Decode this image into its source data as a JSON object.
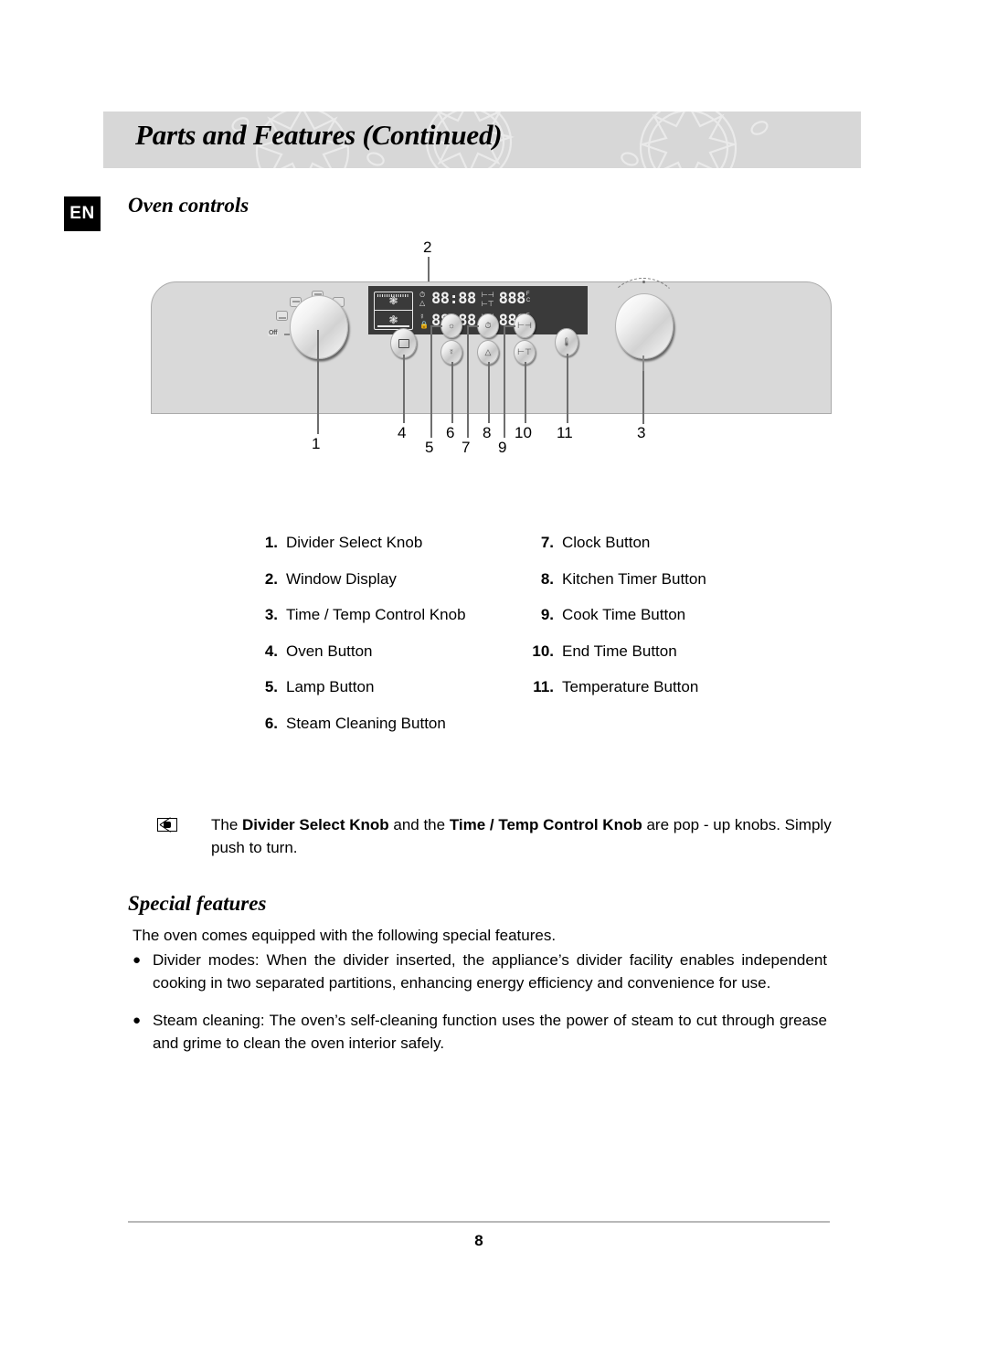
{
  "header": {
    "title": "Parts and Features (Continued)",
    "background_color": "#d7d7d7"
  },
  "language_badge": "EN",
  "sections": {
    "oven_controls_title": "Oven controls",
    "special_features_title": "Special features"
  },
  "diagram": {
    "callouts": [
      {
        "num": "1",
        "label": "Divider Select Knob"
      },
      {
        "num": "2",
        "label": "Window Display"
      },
      {
        "num": "3",
        "label": "Time / Temp Control Knob"
      },
      {
        "num": "4",
        "label": "Oven Button"
      },
      {
        "num": "5",
        "label": "Lamp Button"
      },
      {
        "num": "6",
        "label": "Steam Cleaning Button"
      },
      {
        "num": "7",
        "label": "Clock Button"
      },
      {
        "num": "8",
        "label": "Kitchen Timer Button"
      },
      {
        "num": "9",
        "label": "Cook Time Button"
      },
      {
        "num": "10",
        "label": "End Time Button"
      },
      {
        "num": "11",
        "label": "Temperature Button"
      }
    ],
    "knob_off_label": "Off",
    "lcd": {
      "panel_color": "#3a3a3a",
      "rows": [
        {
          "icons": [
            "clock-icon",
            "bell-icon"
          ],
          "time": "88:88",
          "brackets": [
            "cook-time-icon",
            "end-time-icon"
          ],
          "temperature": "888",
          "units": [
            "F",
            "C"
          ]
        },
        {
          "icons": [
            "steam-icon",
            "lock-icon"
          ],
          "time": "88:88",
          "brackets": [
            "cook-time-icon",
            "end-time-icon"
          ],
          "temperature": "888",
          "units": [
            "F",
            "C"
          ]
        }
      ]
    }
  },
  "parts_list": {
    "left_column": [
      {
        "num": "1.",
        "label": "Divider Select Knob"
      },
      {
        "num": "2.",
        "label": "Window Display"
      },
      {
        "num": "3.",
        "label": "Time / Temp Control Knob"
      },
      {
        "num": "4.",
        "label": "Oven Button"
      },
      {
        "num": "5.",
        "label": "Lamp Button"
      },
      {
        "num": "6.",
        "label": "Steam Cleaning Button"
      }
    ],
    "right_column": [
      {
        "num": "7.",
        "label": "Clock Button"
      },
      {
        "num": "8.",
        "label": "Kitchen Timer Button"
      },
      {
        "num": "9.",
        "label": "Cook Time Button"
      },
      {
        "num": "10.",
        "label": "End Time Button"
      },
      {
        "num": "11.",
        "label": "Temperature Button"
      }
    ]
  },
  "note": {
    "icon": "envelope-icon",
    "part1": "The ",
    "bold1": "Divider Select Knob",
    "part2": " and the ",
    "bold2": "Time / Temp Control Knob",
    "part3": " are pop - up knobs. Simply push to turn."
  },
  "special_features": {
    "intro": "The oven comes equipped with the following special features.",
    "bullet_char": "●",
    "items": [
      "Divider modes: When the divider inserted, the appliance’s divider facility enables independent cooking in two separated partitions, enhancing energy efficiency and convenience for use.",
      "Steam cleaning: The oven’s self-cleaning function uses the power of steam to cut through grease and grime to clean the oven interior safely."
    ]
  },
  "footer": {
    "page_number": "8"
  }
}
